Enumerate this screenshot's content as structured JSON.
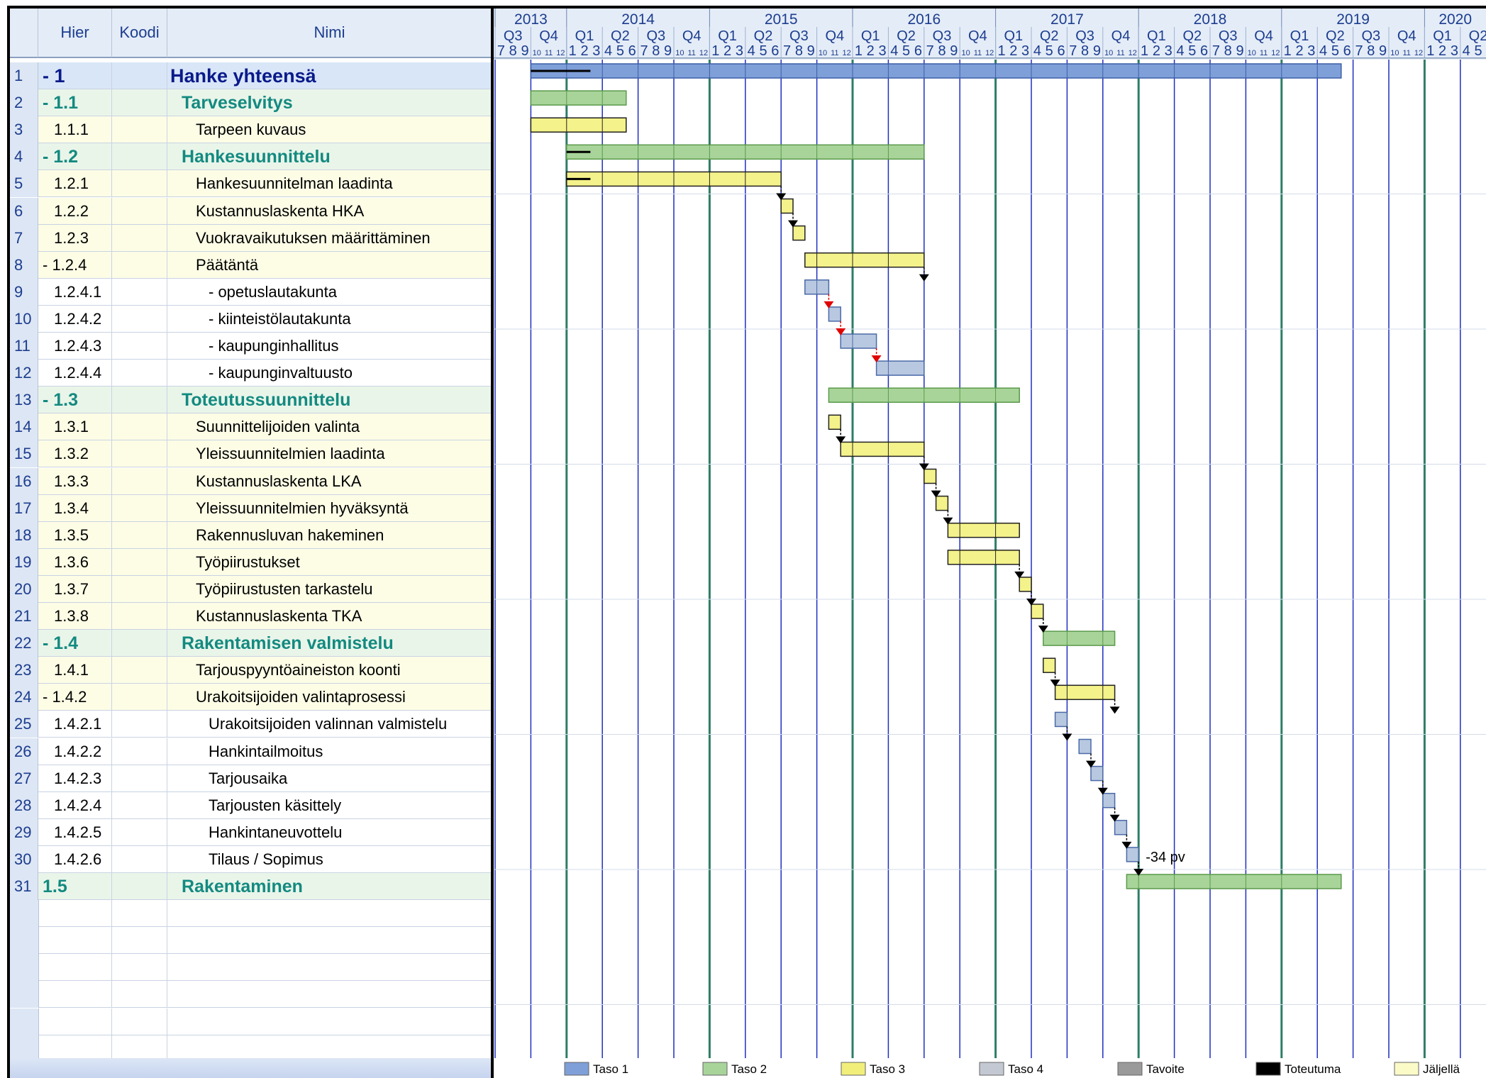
{
  "columns": {
    "hier": "Hier",
    "koodi": "Koodi",
    "nimi": "Nimi"
  },
  "rows": [
    {
      "num": "1",
      "hier": "- 1",
      "name": "Hanke yhteensä",
      "level": 1
    },
    {
      "num": "2",
      "hier": "- 1.1",
      "name": "Tarveselvitys",
      "level": 2
    },
    {
      "num": "3",
      "hier": "1.1.1",
      "name": "Tarpeen kuvaus",
      "level": 3
    },
    {
      "num": "4",
      "hier": "- 1.2",
      "name": "Hankesuunnittelu",
      "level": 2
    },
    {
      "num": "5",
      "hier": "1.2.1",
      "name": "Hankesuunnitelman laadinta",
      "level": 3
    },
    {
      "num": "6",
      "hier": "1.2.2",
      "name": "Kustannuslaskenta HKA",
      "level": 3
    },
    {
      "num": "7",
      "hier": "1.2.3",
      "name": "Vuokravaikutuksen määrittäminen",
      "level": 3
    },
    {
      "num": "8",
      "hier": "- 1.2.4",
      "name": "Päätäntä",
      "level": 3
    },
    {
      "num": "9",
      "hier": "1.2.4.1",
      "name": "- opetuslautakunta",
      "level": 4
    },
    {
      "num": "10",
      "hier": "1.2.4.2",
      "name": "- kiinteistölautakunta",
      "level": 4
    },
    {
      "num": "11",
      "hier": "1.2.4.3",
      "name": "- kaupunginhallitus",
      "level": 4
    },
    {
      "num": "12",
      "hier": "1.2.4.4",
      "name": "- kaupunginvaltuusto",
      "level": 4
    },
    {
      "num": "13",
      "hier": "- 1.3",
      "name": "Toteutussuunnittelu",
      "level": 2
    },
    {
      "num": "14",
      "hier": "1.3.1",
      "name": "Suunnittelijoiden valinta",
      "level": 3
    },
    {
      "num": "15",
      "hier": "1.3.2",
      "name": "Yleissuunnitelmien laadinta",
      "level": 3
    },
    {
      "num": "16",
      "hier": "1.3.3",
      "name": "Kustannuslaskenta LKA",
      "level": 3
    },
    {
      "num": "17",
      "hier": "1.3.4",
      "name": "Yleissuunnitelmien hyväksyntä",
      "level": 3
    },
    {
      "num": "18",
      "hier": "1.3.5",
      "name": "Rakennusluvan hakeminen",
      "level": 3
    },
    {
      "num": "19",
      "hier": "1.3.6",
      "name": "Työpiirustukset",
      "level": 3
    },
    {
      "num": "20",
      "hier": "1.3.7",
      "name": "Työpiirustusten tarkastelu",
      "level": 3
    },
    {
      "num": "21",
      "hier": "1.3.8",
      "name": "Kustannuslaskenta TKA",
      "level": 3
    },
    {
      "num": "22",
      "hier": "- 1.4",
      "name": "Rakentamisen valmistelu",
      "level": 2
    },
    {
      "num": "23",
      "hier": "1.4.1",
      "name": "Tarjouspyyntöaineiston koonti",
      "level": 3
    },
    {
      "num": "24",
      "hier": "- 1.4.2",
      "name": "Urakoitsijoiden valintaprosessi",
      "level": 3
    },
    {
      "num": "25",
      "hier": "1.4.2.1",
      "name": "Urakoitsijoiden valinnan valmistelu",
      "level": 4
    },
    {
      "num": "26",
      "hier": "1.4.2.2",
      "name": "Hankintailmoitus",
      "level": 4
    },
    {
      "num": "27",
      "hier": "1.4.2.3",
      "name": "Tarjousaika",
      "level": 4
    },
    {
      "num": "28",
      "hier": "1.4.2.4",
      "name": "Tarjousten käsittely",
      "level": 4
    },
    {
      "num": "29",
      "hier": "1.4.2.5",
      "name": "Hankintaneuvottelu",
      "level": 4
    },
    {
      "num": "30",
      "hier": "1.4.2.6",
      "name": "Tilaus / Sopimus",
      "level": 4
    },
    {
      "num": "31",
      "hier": "1.5",
      "name": "Rakentaminen",
      "level": 2
    }
  ],
  "timeline": {
    "years": [
      "2013",
      "2014",
      "2015",
      "2016",
      "2017",
      "2018",
      "2019",
      "2020"
    ],
    "quarters": [
      "Q3",
      "Q4",
      "Q1",
      "Q2",
      "Q3",
      "Q4",
      "Q1",
      "Q2",
      "Q3",
      "Q4",
      "Q1",
      "Q2",
      "Q3",
      "Q4",
      "Q1",
      "Q2",
      "Q3",
      "Q4",
      "Q1",
      "Q2",
      "Q3",
      "Q4",
      "Q1",
      "Q2",
      "Q3",
      "Q4",
      "Q1",
      "Q2"
    ],
    "month_digits": "1 2 3 4 5 6 7 8 9"
  },
  "bars": [
    {
      "row": 1,
      "level": 1,
      "start": "2013-10",
      "end": "2019-06"
    },
    {
      "row": 2,
      "level": 2,
      "start": "2013-10",
      "end": "2014-06"
    },
    {
      "row": 3,
      "level": 3,
      "start": "2013-10",
      "end": "2014-06"
    },
    {
      "row": 4,
      "level": 2,
      "start": "2014-01",
      "end": "2016-07"
    },
    {
      "row": 5,
      "level": 3,
      "start": "2014-01",
      "end": "2015-07"
    },
    {
      "row": 6,
      "level": 3,
      "start": "2015-07",
      "end": "2015-08"
    },
    {
      "row": 7,
      "level": 3,
      "start": "2015-08",
      "end": "2015-09"
    },
    {
      "row": 8,
      "level": 3,
      "start": "2015-09",
      "end": "2016-07"
    },
    {
      "row": 9,
      "level": 4,
      "start": "2015-09",
      "end": "2015-11"
    },
    {
      "row": 10,
      "level": 4,
      "start": "2015-11",
      "end": "2015-12"
    },
    {
      "row": 11,
      "level": 4,
      "start": "2015-12",
      "end": "2016-03"
    },
    {
      "row": 12,
      "level": 4,
      "start": "2016-03",
      "end": "2016-07"
    },
    {
      "row": 13,
      "level": 2,
      "start": "2015-11",
      "end": "2017-03"
    },
    {
      "row": 14,
      "level": 3,
      "start": "2015-11",
      "end": "2015-12"
    },
    {
      "row": 15,
      "level": 3,
      "start": "2015-12",
      "end": "2016-07"
    },
    {
      "row": 16,
      "level": 3,
      "start": "2016-07",
      "end": "2016-08"
    },
    {
      "row": 17,
      "level": 3,
      "start": "2016-08",
      "end": "2016-09"
    },
    {
      "row": 18,
      "level": 3,
      "start": "2016-09",
      "end": "2017-03"
    },
    {
      "row": 19,
      "level": 3,
      "start": "2016-09",
      "end": "2017-03"
    },
    {
      "row": 20,
      "level": 3,
      "start": "2017-03",
      "end": "2017-04"
    },
    {
      "row": 21,
      "level": 3,
      "start": "2017-04",
      "end": "2017-05"
    },
    {
      "row": 22,
      "level": 2,
      "start": "2017-05",
      "end": "2017-11"
    },
    {
      "row": 23,
      "level": 3,
      "start": "2017-05",
      "end": "2017-06"
    },
    {
      "row": 24,
      "level": 3,
      "start": "2017-06",
      "end": "2017-11"
    },
    {
      "row": 25,
      "level": 4,
      "start": "2017-06",
      "end": "2017-07"
    },
    {
      "row": 26,
      "level": 4,
      "start": "2017-08",
      "end": "2017-09"
    },
    {
      "row": 27,
      "level": 4,
      "start": "2017-09",
      "end": "2017-10"
    },
    {
      "row": 28,
      "level": 4,
      "start": "2017-10",
      "end": "2017-11"
    },
    {
      "row": 29,
      "level": 4,
      "start": "2017-11",
      "end": "2017-12"
    },
    {
      "row": 30,
      "level": 4,
      "start": "2017-12",
      "end": "2018-01"
    },
    {
      "row": 31,
      "level": 2,
      "start": "2017-12",
      "end": "2019-06"
    }
  ],
  "annotation": "-34 pv",
  "legend": [
    {
      "label": "Taso 1",
      "color": "#7f9fd8"
    },
    {
      "label": "Taso 2",
      "color": "#a8d49a"
    },
    {
      "label": "Taso 3",
      "color": "#f1ef7a"
    },
    {
      "label": "Taso 4",
      "color": "#c4c8d2"
    },
    {
      "label": "Tavoite",
      "color": "#9a9a9a"
    },
    {
      "label": "Toteutuma",
      "color": "#000000"
    },
    {
      "label": "Jäljellä",
      "color": "#fbfbc8"
    }
  ],
  "colors": {
    "taso1_fill": "#7f9fd8",
    "taso1_stroke": "#3c5fa8",
    "taso2_fill": "#a8d49a",
    "taso2_stroke": "#5a9a4a",
    "taso3_fill": "#f4f28a",
    "taso3_stroke": "#222222",
    "taso4_fill": "#b8c8e0",
    "taso4_stroke": "#4a6aa8",
    "year_line": "#2e7d66",
    "quarter_line": "#1f2fbf",
    "critical": "#e00000"
  }
}
